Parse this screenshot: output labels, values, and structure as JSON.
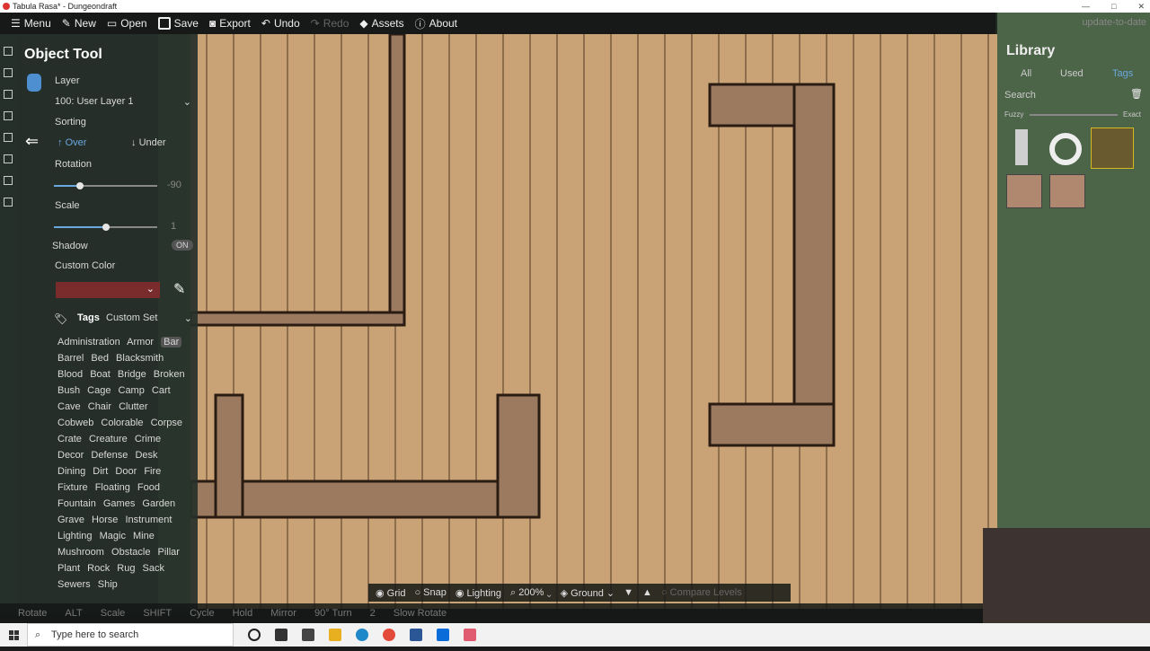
{
  "window": {
    "title": "Tabula Rasa* - Dungeondraft",
    "controls": [
      "—",
      "□",
      "✕"
    ]
  },
  "toolbar": {
    "menu": "Menu",
    "new": "New",
    "open": "Open",
    "save": "Save",
    "export": "Export",
    "undo": "Undo",
    "redo": "Redo",
    "assets": "Assets",
    "about": "About",
    "update": "update-to-date"
  },
  "left": {
    "title": "Object Tool",
    "layer_label": "Layer",
    "layer_value": "100: User Layer 1",
    "sorting_label": "Sorting",
    "over": "Over",
    "under": "Under",
    "rotation_label": "Rotation",
    "rotation_value": "-90",
    "rotation_fraction": 0.25,
    "scale_label": "Scale",
    "scale_value": "1",
    "scale_fraction": 0.5,
    "shadow_label": "Shadow",
    "shadow_value": "ON",
    "custom_color_label": "Custom Color",
    "custom_color": "#7a2c2c",
    "tags_label": "Tags",
    "tags_set": "Custom Set",
    "tags": [
      "Administration",
      "Armor",
      "Bar",
      "Barrel",
      "Bed",
      "Blacksmith",
      "Blood",
      "Boat",
      "Bridge",
      "Broken",
      "Bush",
      "Cage",
      "Camp",
      "Cart",
      "Cave",
      "Chair",
      "Clutter",
      "Cobweb",
      "Colorable",
      "Corpse",
      "Crate",
      "Creature",
      "Crime",
      "Decor",
      "Defense",
      "Desk",
      "Dining",
      "Dirt",
      "Door",
      "Fire",
      "Fixture",
      "Floating",
      "Food",
      "Fountain",
      "Games",
      "Garden",
      "Grave",
      "Horse",
      "Instrument",
      "Lighting",
      "Magic",
      "Mine",
      "Mushroom",
      "Obstacle",
      "Pillar",
      "Plant",
      "Rock",
      "Rug",
      "Sack",
      "Sewers",
      "Ship"
    ],
    "selected_tag": "Bar"
  },
  "library": {
    "title": "Library",
    "tabs": [
      "All",
      "Used",
      "Tags"
    ],
    "search": "Search",
    "fuzzy": "Fuzzy",
    "exact": "Exact"
  },
  "bottombar": {
    "grid": "Grid",
    "snap": "Snap",
    "lighting": "Lighting",
    "zoom": "200%",
    "level": "Ground",
    "compare": "Compare Levels"
  },
  "status": {
    "rotate": "Rotate",
    "scale": "Scale",
    "shift": "SHIFT",
    "cycle": "Cycle",
    "hold": "Hold",
    "mirror": "Mirror",
    "turn": "90° Turn",
    "slow": "Slow Rotate",
    "alt": "ALT",
    "shortcut2": "2"
  },
  "taskbar": {
    "search_placeholder": "Type here to search"
  }
}
